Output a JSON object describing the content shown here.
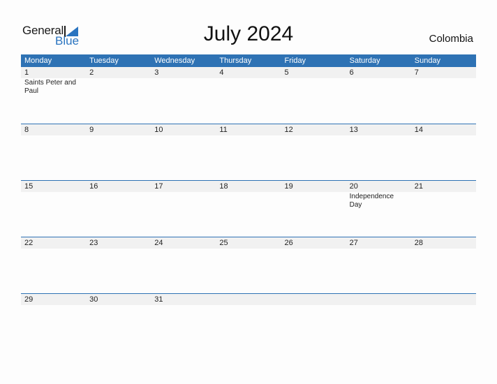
{
  "logo": {
    "line1": "General",
    "line2": "Blue"
  },
  "title": "July 2024",
  "country": "Colombia",
  "colors": {
    "header_bg": "#2e72b4",
    "day_band": "#f1f1f1",
    "logo_blue": "#2a74c0"
  },
  "weekdays": [
    "Monday",
    "Tuesday",
    "Wednesday",
    "Thursday",
    "Friday",
    "Saturday",
    "Sunday"
  ],
  "weeks": [
    {
      "days": [
        "1",
        "2",
        "3",
        "4",
        "5",
        "6",
        "7"
      ],
      "events": [
        "Saints Peter and Paul",
        "",
        "",
        "",
        "",
        "",
        ""
      ]
    },
    {
      "days": [
        "8",
        "9",
        "10",
        "11",
        "12",
        "13",
        "14"
      ],
      "events": [
        "",
        "",
        "",
        "",
        "",
        "",
        ""
      ]
    },
    {
      "days": [
        "15",
        "16",
        "17",
        "18",
        "19",
        "20",
        "21"
      ],
      "events": [
        "",
        "",
        "",
        "",
        "",
        "Independence Day",
        ""
      ]
    },
    {
      "days": [
        "22",
        "23",
        "24",
        "25",
        "26",
        "27",
        "28"
      ],
      "events": [
        "",
        "",
        "",
        "",
        "",
        "",
        ""
      ]
    },
    {
      "days": [
        "29",
        "30",
        "31",
        "",
        "",
        "",
        ""
      ],
      "events": [
        "",
        "",
        "",
        "",
        "",
        "",
        ""
      ]
    }
  ]
}
